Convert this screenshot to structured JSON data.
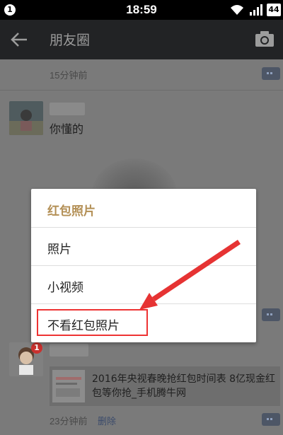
{
  "status_bar": {
    "notification_count": "1",
    "time": "18:59",
    "battery": "44",
    "icons": [
      "wifi-icon",
      "signal-icon"
    ]
  },
  "header": {
    "title": "朋友圈",
    "back_icon": "arrow-left-icon",
    "camera_icon": "camera-icon"
  },
  "feed": {
    "post_1": {
      "time": "15分钟前"
    },
    "post_2": {
      "text": "你懂的"
    },
    "post_3": {
      "badge": "1",
      "link_title": "2016年央视春晚抢红包时间表 8亿现金红包等你抢_手机腾牛网",
      "time": "23分钟前",
      "delete_label": "删除"
    }
  },
  "dialog": {
    "title": "红包照片",
    "options": [
      "照片",
      "小视频",
      "不看红包照片"
    ]
  },
  "colors": {
    "dialog_title": "#b38f55",
    "highlight": "#e33333",
    "app_bar": "#222325",
    "dim_overlay": "#7a7a7a"
  }
}
